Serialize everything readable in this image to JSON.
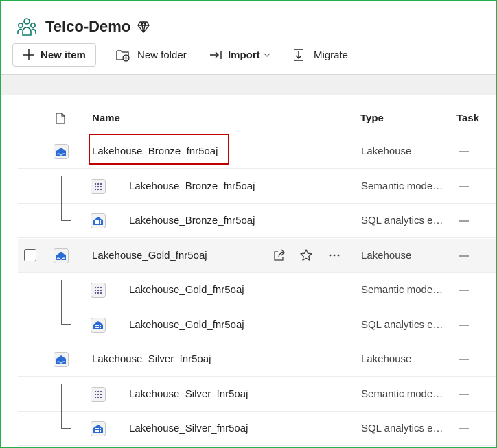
{
  "workspace": {
    "title": "Telco-Demo",
    "icon": "workspace-people-icon",
    "badge_icon": "premium-diamond-icon"
  },
  "toolbar": {
    "new_item": "New item",
    "new_folder": "New folder",
    "import": "Import",
    "migrate": "Migrate"
  },
  "table": {
    "headers": {
      "name": "Name",
      "type": "Type",
      "task": "Task"
    },
    "rows": [
      {
        "name": "Lakehouse_Bronze_fnr5oaj",
        "type": "Lakehouse",
        "task": "—",
        "icon": "lakehouse-icon"
      },
      {
        "name": "Lakehouse_Bronze_fnr5oaj",
        "type": "Semantic mode…",
        "task": "—",
        "icon": "semantic-model-icon"
      },
      {
        "name": "Lakehouse_Bronze_fnr5oaj",
        "type": "SQL analytics e…",
        "task": "—",
        "icon": "sql-endpoint-icon"
      },
      {
        "name": "Lakehouse_Gold_fnr5oaj",
        "type": "Lakehouse",
        "task": "—",
        "icon": "lakehouse-icon"
      },
      {
        "name": "Lakehouse_Gold_fnr5oaj",
        "type": "Semantic mode…",
        "task": "—",
        "icon": "semantic-model-icon"
      },
      {
        "name": "Lakehouse_Gold_fnr5oaj",
        "type": "SQL analytics e…",
        "task": "—",
        "icon": "sql-endpoint-icon"
      },
      {
        "name": "Lakehouse_Silver_fnr5oaj",
        "type": "Lakehouse",
        "task": "—",
        "icon": "lakehouse-icon"
      },
      {
        "name": "Lakehouse_Silver_fnr5oaj",
        "type": "Semantic mode…",
        "task": "—",
        "icon": "semantic-model-icon"
      },
      {
        "name": "Lakehouse_Silver_fnr5oaj",
        "type": "SQL analytics e…",
        "task": "—",
        "icon": "sql-endpoint-icon"
      }
    ]
  },
  "colors": {
    "highlight_box": "#c00000",
    "lakehouse_blue": "#2b6bd6"
  }
}
